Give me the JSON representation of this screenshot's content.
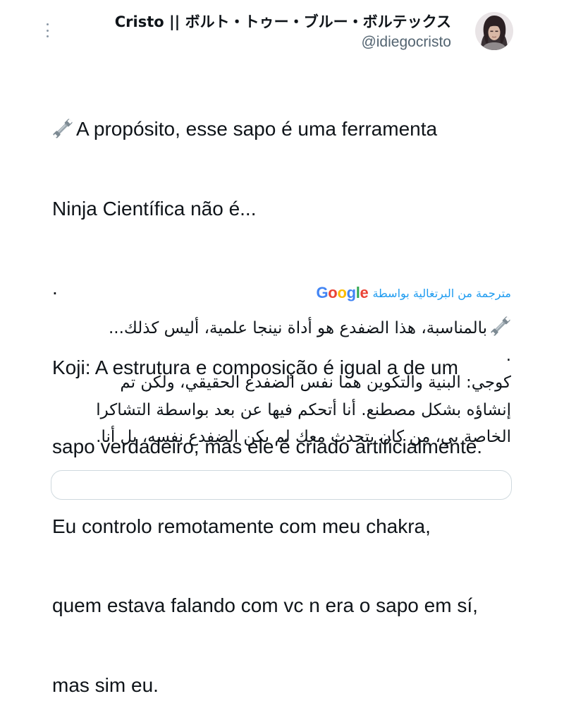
{
  "author": {
    "display_name": "Cristo || ボルト・トゥー・ブルー・ボルテックス",
    "handle": "@idiegocristo"
  },
  "tweet": {
    "lines": [
      "A propósito, esse sapo é uma ferramenta",
      "Ninja Científica não é...",
      ".",
      "Koji: A estrutura e composição é igual a de um",
      "sapo verdadeiro, mas ele é criado artificialmente.",
      "Eu controlo remotamente com meu chakra,",
      "quem estava falando com vc n era o sapo em sí,",
      "mas sim eu."
    ]
  },
  "translation": {
    "credit_label": "مترجمة من البرتغالية بواسطة",
    "provider": "Google",
    "provider_colors": [
      "#4285F4",
      "#EA4335",
      "#FBBC05",
      "#4285F4",
      "#34A853",
      "#EA4335"
    ],
    "lines": [
      "بالمناسبة، هذا الضفدع هو أداة نينجا علمية، أليس كذلك...",
      ".",
      "كوجي: البنية والتكوين هما نفس الضفدع الحقيقي، ولكن تم",
      "إنشاؤه بشكل مصطنع. أنا أتحكم فيها عن بعد بواسطة التشاكرا",
      "الخاصة بي، من كان يتحدث معك لم يكن الضفدع نفسه، بل أنا."
    ]
  },
  "icons": {
    "more": "more-dots-icon",
    "tool": "wrench-emoji-icon",
    "avatar": "user-avatar"
  },
  "colors": {
    "link_blue": "#1d9bf0",
    "text_primary": "#0f1419",
    "text_secondary": "#536471"
  }
}
